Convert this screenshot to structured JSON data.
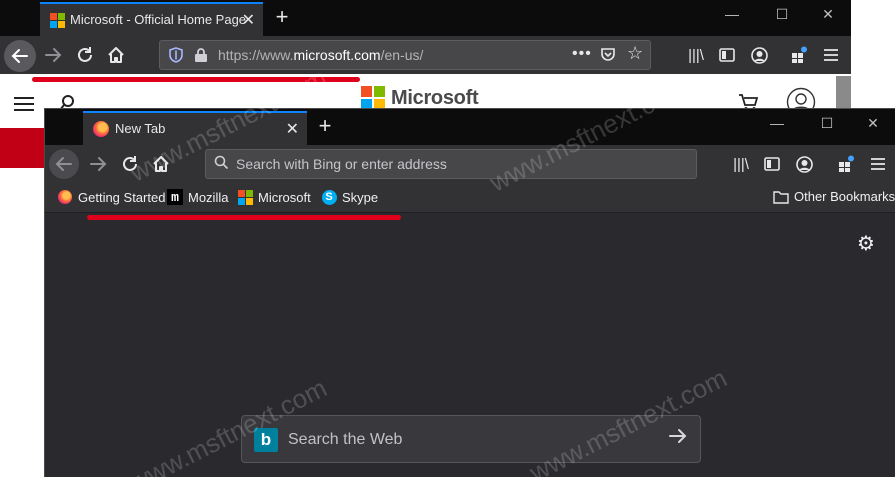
{
  "colors": {
    "accent": "#0a84ff",
    "highlight_red": "#e0001b",
    "ms_red": "#f25022",
    "ms_green": "#7fba00",
    "ms_blue": "#00a4ef",
    "ms_yellow": "#ffb900"
  },
  "back_window": {
    "tab": {
      "title": "Microsoft - Official Home Page",
      "icon": "microsoft-logo-icon"
    },
    "url": {
      "prefix": "https://www.",
      "domain": "microsoft.com",
      "path": "/en-us/"
    },
    "page": {
      "brand_text": "Microsoft"
    }
  },
  "front_window": {
    "tab": {
      "title": "New Tab",
      "icon": "firefox-icon"
    },
    "urlbar": {
      "placeholder": "Search with Bing or enter address"
    },
    "bookmarks": [
      {
        "label": "Getting Started",
        "icon": "firefox-icon"
      },
      {
        "label": "Mozilla",
        "icon": "mozilla-icon"
      },
      {
        "label": "Microsoft",
        "icon": "microsoft-logo-icon"
      },
      {
        "label": "Skype",
        "icon": "skype-icon"
      }
    ],
    "other_bookmarks": "Other Bookmarks",
    "web_search": {
      "placeholder": "Search the Web",
      "icon": "bing-icon"
    }
  },
  "watermark": "www.msftnext.com"
}
